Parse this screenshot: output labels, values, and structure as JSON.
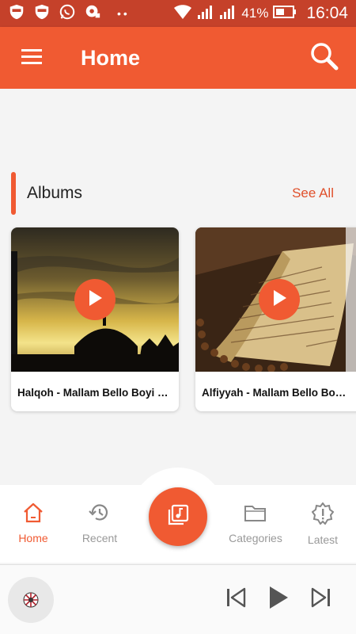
{
  "status": {
    "battery": "41%",
    "time": "16:04"
  },
  "appbar": {
    "title": "Home"
  },
  "albums": {
    "title": "Albums",
    "see_all": "See All",
    "items": [
      {
        "title": "Halqoh - Mallam Bello Boyi U..."
      },
      {
        "title": "Alfiyyah - Mallam Bello Boyi ..."
      }
    ]
  },
  "nav": {
    "items": [
      {
        "label": "Home"
      },
      {
        "label": "Recent"
      },
      {
        "label": "Categories"
      },
      {
        "label": "Latest"
      }
    ]
  },
  "colors": {
    "accent": "#f05a32",
    "status_bar": "#c5412a"
  }
}
